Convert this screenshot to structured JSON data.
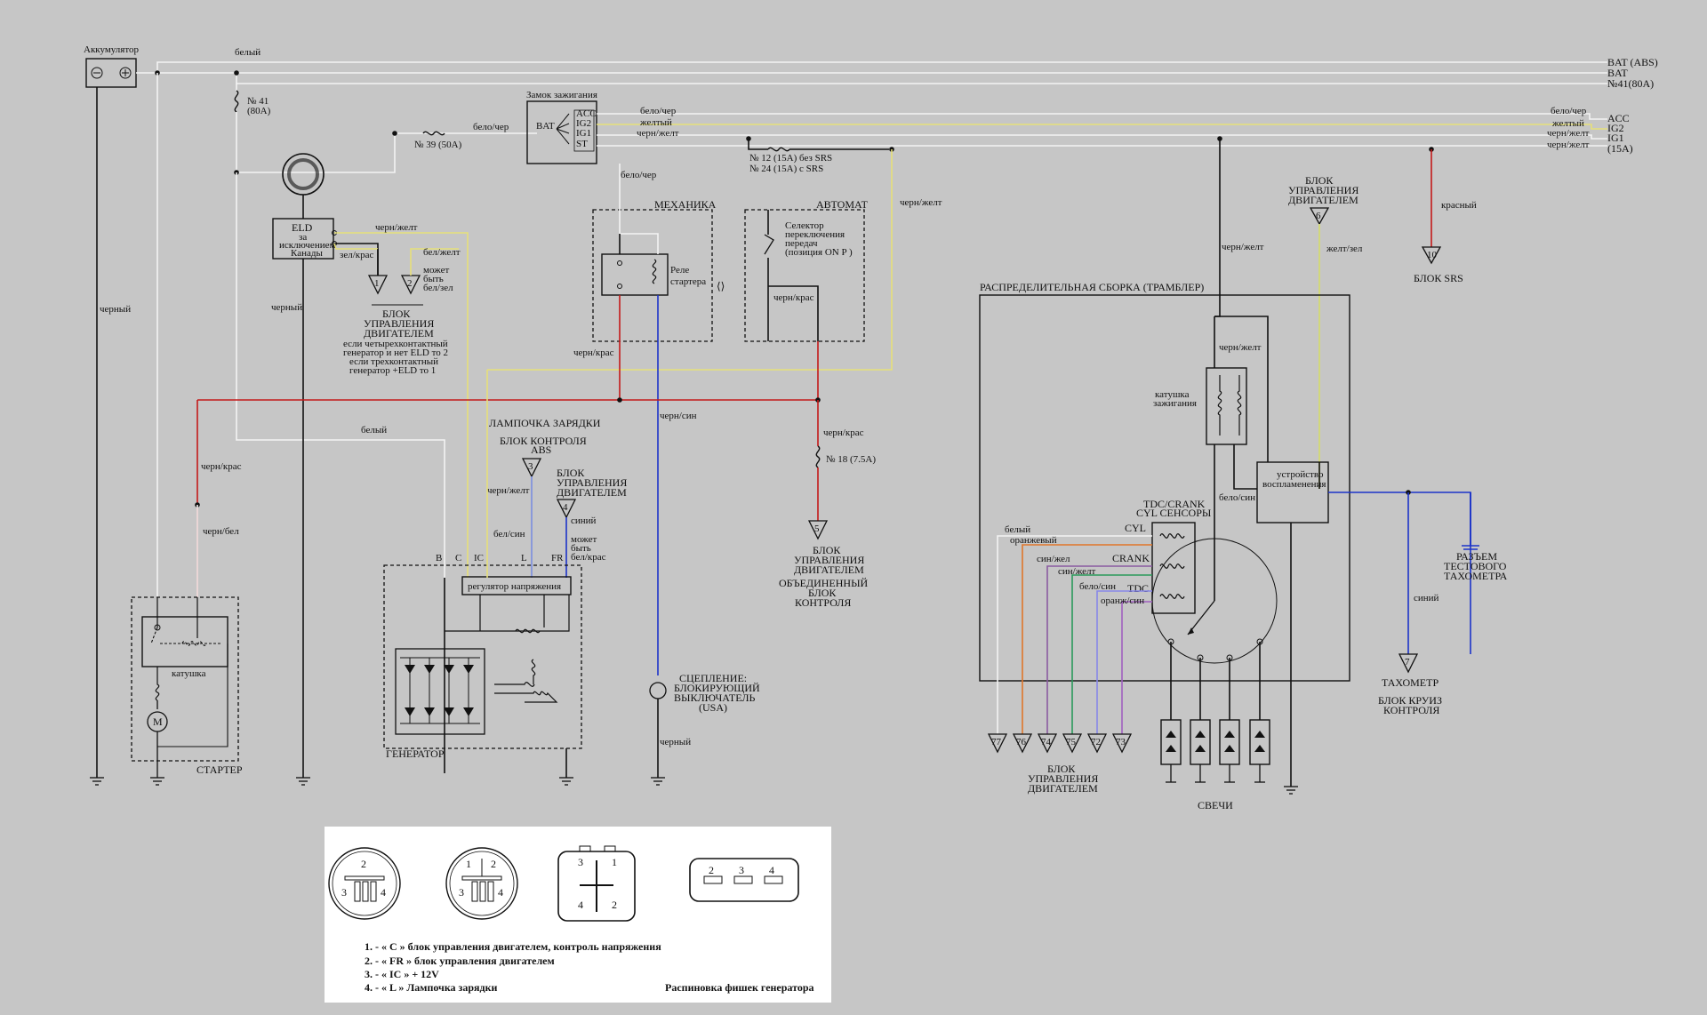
{
  "battery": {
    "label": "Аккумулятор"
  },
  "wires": {
    "white": "белый",
    "black": "черный",
    "wht_blk": "бело/чер",
    "yellow": "желтый",
    "blk_yel": "черн/желт",
    "blk_red": "черн/крас",
    "blk_wht": "черн/бел",
    "blk_blu": "черн/син",
    "grn_red": "зел/крас",
    "wht_yel": "бел/желт",
    "wht_blu": "бел/син",
    "blu_blk": "бело/син",
    "red": "красный",
    "blue": "синий",
    "yel_grn": "желт/зел",
    "orange": "оранжевый",
    "blu_wht": "син/жел",
    "blu_yel": "син/желт",
    "wht_blk_b": "бело/син",
    "org_blu": "оранж/син",
    "blk_yel_b": "черн/желт"
  },
  "right_buses": [
    "BAT (ABS)",
    "BAT",
    "№41(80A)",
    "ACC",
    "IG2",
    "IG1",
    "(15A)"
  ],
  "fuse41": {
    "number": "№ 41",
    "rating": "(80A)"
  },
  "fuse39": "№ 39  (50A)",
  "fuse12": "№ 12 (15A) без SRS",
  "fuse24": "№ 24 (15A) с SRS",
  "fuse18": "№ 18  (7.5A)",
  "ignition": {
    "label": "Замок зажигания",
    "pins": [
      "BAT",
      "ACC",
      "IG2",
      "IG1",
      "ST"
    ]
  },
  "eld": {
    "title": "ELD",
    "lines": [
      "за",
      "исключением",
      "Канады"
    ]
  },
  "ecu_block1": {
    "pins": [
      "1",
      "2"
    ],
    "note": [
      "может",
      "быть",
      "бел/зел"
    ],
    "title": [
      "БЛОК",
      "УПРАВЛЕНИЯ",
      "ДВИГАТЕЛЕМ"
    ],
    "desc": [
      "если четырехконтактный",
      "генератор и нет ELD то 2",
      "если трехконтактный",
      "генератор +ELD то 1"
    ]
  },
  "mechanics": {
    "label": "МЕХАНИКА",
    "relay": [
      "Реле",
      "стартера"
    ]
  },
  "automatic": {
    "label": "АВТОМАТ",
    "selector": [
      "Селектор",
      "переключения",
      "передач",
      "(позиция ON P )"
    ]
  },
  "charge_lamp": "ЛАМПОЧКА ЗАРЯДКИ",
  "abs_block": {
    "title": [
      "БЛОК КОНТРОЛЯ",
      "ABS"
    ],
    "pin": "3"
  },
  "ecu_block2": {
    "title": [
      "БЛОК",
      "УПРАВЛЕНИЯ",
      "ДВИГАТЕЛЕМ"
    ],
    "pin": "4",
    "note": [
      "может",
      "быть",
      "бел/крас"
    ]
  },
  "generator": {
    "label": "ГЕНЕРАТОР",
    "regulator": "регулятор напряжения",
    "pins": [
      "B",
      "C",
      "IC",
      "L",
      "FR"
    ]
  },
  "starter": {
    "label": "СТАРТЕР",
    "coil": "катушка",
    "motor": "M"
  },
  "clutch": [
    "СЦЕПЛЕНИЕ:",
    "БЛОКИРУЮЩИЙ",
    "ВЫКЛЮЧАТЕЛЬ",
    "(USA)"
  ],
  "ecu_block5": {
    "pin": "5",
    "title": [
      "БЛОК",
      "УПРАВЛЕНИЯ",
      "ДВИГАТЕЛЕМ"
    ],
    "combined": [
      "ОБЪЕДИНЕННЫЙ",
      "БЛОК",
      "КОНТРОЛЯ"
    ]
  },
  "ecu_block6": {
    "title": [
      "БЛОК",
      "УПРАВЛЕНИЯ",
      "ДВИГАТЕЛЕМ"
    ],
    "pin": "6"
  },
  "srs_block": {
    "pin": "10",
    "label": "БЛОК SRS"
  },
  "distributor": {
    "label": "РАСПРЕДЕЛИТЕЛЬНАЯ СБОРКА (ТРАМБЛЕР)",
    "coil": [
      "катушка",
      "зажигания"
    ],
    "igniter": [
      "устройство",
      "воспламенения"
    ],
    "sensors_title": [
      "TDC/CRANK",
      "CYL СЕНСОРЫ"
    ],
    "sensors": [
      "CYL",
      "CRANK",
      "TDC"
    ],
    "ecu_pins": [
      "77",
      "76",
      "74",
      "75",
      "72",
      "73"
    ],
    "ecu_title": [
      "БЛОК",
      "УПРАВЛЕНИЯ",
      "ДВИГАТЕЛЕМ"
    ],
    "plugs": "СВЕЧИ"
  },
  "test_connector": [
    "РАЗЪЕМ",
    "ТЕСТОВОГО",
    "ТАХОМЕТРА"
  ],
  "tachometer": {
    "pin": "7",
    "label": "ТАХОМЕТР",
    "block": [
      "БЛОК КРУИЗ",
      "КОНТРОЛЯ"
    ]
  },
  "pinout": {
    "connector1": [
      "2",
      "3",
      "4"
    ],
    "connector2": [
      "1",
      "2",
      "3",
      "4"
    ],
    "connector3": [
      "3",
      "1",
      "4",
      "2"
    ],
    "connector4": [
      "2",
      "3",
      "4"
    ],
    "legend": [
      "1.  - « C » блок управления двигателем, контроль напряжения",
      "2.  - « FR » блок управления двигателем",
      "3.  - « IC » + 12V",
      "4.  - « L »  Лампочка зарядки"
    ],
    "title": "Распиновка фишек генератора"
  },
  "colors": {
    "background": "#c6c6c6",
    "red": "#c41a1a",
    "yellow": "#e6e07a",
    "blue": "#1c33c8",
    "white": "#f4f4f4"
  }
}
